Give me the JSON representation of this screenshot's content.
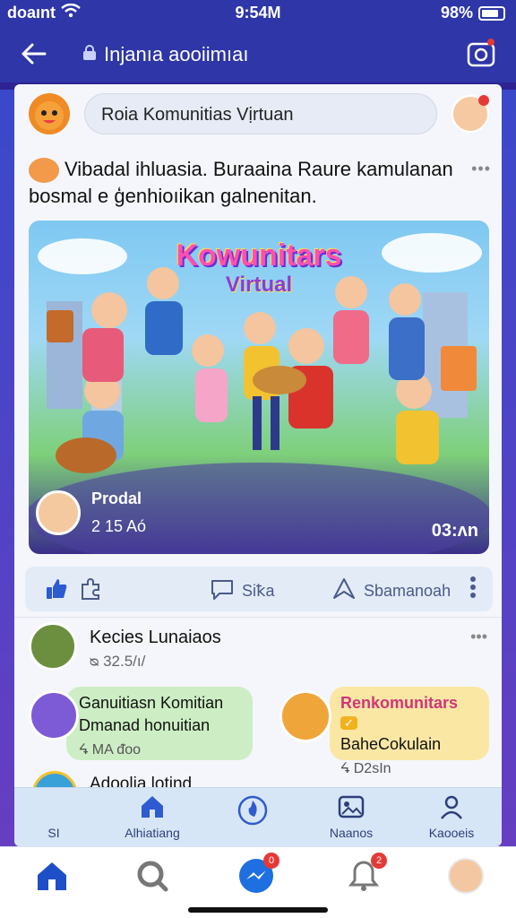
{
  "status": {
    "carrier": "doaınt",
    "time": "9:54M",
    "battery": "98%"
  },
  "topbar": {
    "title": "Injanıa aooiimıaı"
  },
  "search": {
    "placeholder": "Roia Komunitias Vịrtuan"
  },
  "post": {
    "text": "Vibadal ihluasia. Buraaina Raure kamulanan bosmal e ģenhioıikan galnenitan.",
    "hero_title": "Kowunitars",
    "hero_subtitle": "Virtual",
    "author_name": "Prodal",
    "author_meta": "2 15 Aó",
    "time": "03:ʌn"
  },
  "actions": {
    "comment": "Siꝁa",
    "share": "Sbamanoah"
  },
  "member": {
    "name": "Kecies Lunaiaos",
    "meta": "ᴓ 32.5/ı/"
  },
  "suggestions": [
    {
      "line1": "Ganuitiasn Komitian",
      "line2": "Dmanad honuitian",
      "line3": "ᖧ MA ᵭoo",
      "bg": "#cdeec4"
    },
    {
      "line1": "Renkomunitars",
      "tag": "✓",
      "line2": "BaheCokulain",
      "line3": "ᖧ D2sIn",
      "bg": "#fbe7a4"
    }
  ],
  "partial": {
    "name": "Adoolia lotind"
  },
  "subnav": [
    {
      "label": "SI",
      "icon": "avatar-icon"
    },
    {
      "label": "Alhiatiang",
      "icon": "home-icon"
    },
    {
      "label": "",
      "icon": "flame-icon"
    },
    {
      "label": "Naanos",
      "icon": "image-icon"
    },
    {
      "label": "Kaooeis",
      "icon": "person-icon"
    }
  ],
  "bottomnav": {
    "badges": [
      "0",
      "2"
    ]
  },
  "colors": {
    "primary": "#2e36a8",
    "accent": "#1e6fe0",
    "badge": "#e53935"
  }
}
